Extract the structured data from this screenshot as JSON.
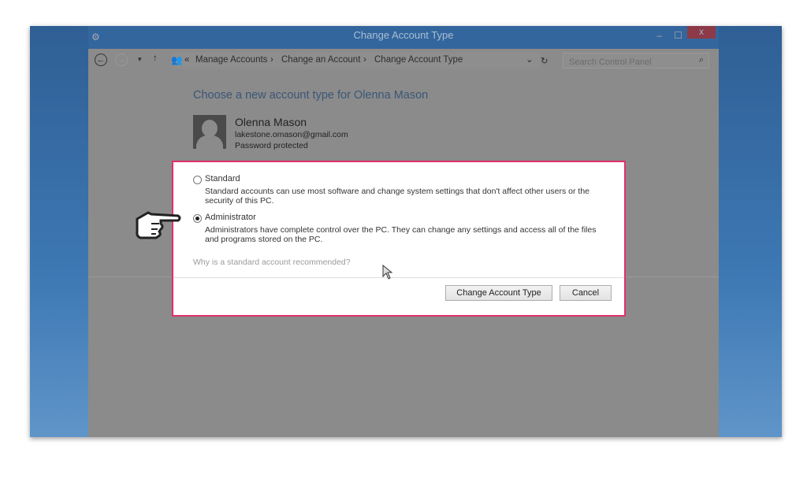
{
  "window": {
    "title": "Change Account Type",
    "minimize": "–",
    "maximize": "☐",
    "close": "x"
  },
  "address": {
    "back": "←",
    "forward": "→",
    "recent": "▾",
    "up": "↑",
    "overflow": "«",
    "crumbs": [
      "Manage Accounts",
      "Change an Account",
      "Change Account Type"
    ],
    "separator": "›",
    "dropdown": "⌄",
    "refresh": "↻",
    "search_placeholder": "Search Control Panel",
    "search_icon": "⌕"
  },
  "main": {
    "heading": "Choose a new account type for Olenna Mason",
    "user": {
      "name": "Olenna Mason",
      "email": "lakestone.omason@gmail.com",
      "status": "Password protected"
    }
  },
  "dialog": {
    "options": [
      {
        "label": "Standard",
        "description_line1": "Standard accounts can use most software and change system settings that don't affect other users or the",
        "description_line2": "security of this PC.",
        "selected": false
      },
      {
        "label": "Administrator",
        "description_line1": "Administrators have complete control over the PC. They can change any settings and access all of the files",
        "description_line2": "and programs stored on the PC.",
        "selected": true
      }
    ],
    "help_link": "Why is a standard account recommended?",
    "confirm_label": "Change Account Type",
    "cancel_label": "Cancel"
  },
  "colors": {
    "highlight_border": "#e0306a",
    "titlebar": "#33669c",
    "heading": "#3a5677"
  }
}
